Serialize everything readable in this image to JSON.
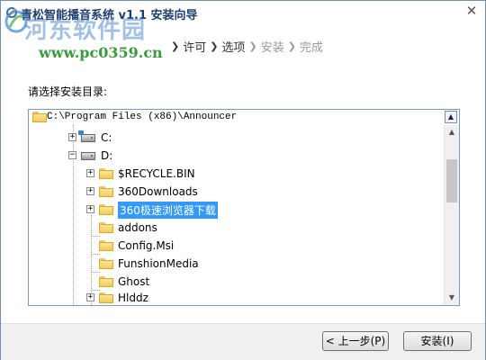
{
  "window": {
    "title": "青松智能播音系统 v1.1 安装向导",
    "close_glyph": "✕",
    "watermark_logo": "河东软件园",
    "watermark_url": "www.pc0359.cn"
  },
  "steps": [
    {
      "label": "许可",
      "state": "done"
    },
    {
      "label": "选项",
      "state": "current"
    },
    {
      "label": "安装",
      "state": "pending"
    },
    {
      "label": "完成",
      "state": "pending"
    }
  ],
  "step_arrow": "❯",
  "content": {
    "prompt": "请选择安装目录:",
    "path": "C:\\Program Files (x86)\\Announcer",
    "up_glyph": "▲"
  },
  "tree": {
    "expander_plus": "+",
    "expander_minus": "−",
    "drives": [
      {
        "label": "C:",
        "expanded": false,
        "icon": "network-drive-icon"
      },
      {
        "label": "D:",
        "expanded": true,
        "icon": "hard-drive-icon"
      }
    ],
    "folders": [
      {
        "label": "$RECYCLE.BIN",
        "has_children": true,
        "selected": false
      },
      {
        "label": "360Downloads",
        "has_children": true,
        "selected": false
      },
      {
        "label": "360极速浏览器下载",
        "has_children": true,
        "selected": true
      },
      {
        "label": "addons",
        "has_children": false,
        "selected": false
      },
      {
        "label": "Config.Msi",
        "has_children": false,
        "selected": false
      },
      {
        "label": "FunshionMedia",
        "has_children": false,
        "selected": false
      },
      {
        "label": "Ghost",
        "has_children": false,
        "selected": false
      },
      {
        "label": "Hlddz",
        "has_children": true,
        "selected": false
      }
    ],
    "scroll_up_glyph": "▲",
    "scroll_down_glyph": "▼"
  },
  "footer": {
    "back_label": "< 上一步(P)",
    "install_label": "安装(I)"
  },
  "colors": {
    "selection": "#3399ff",
    "title_text": "#1f3e6e",
    "watermark_green": "#3b9a3b"
  }
}
